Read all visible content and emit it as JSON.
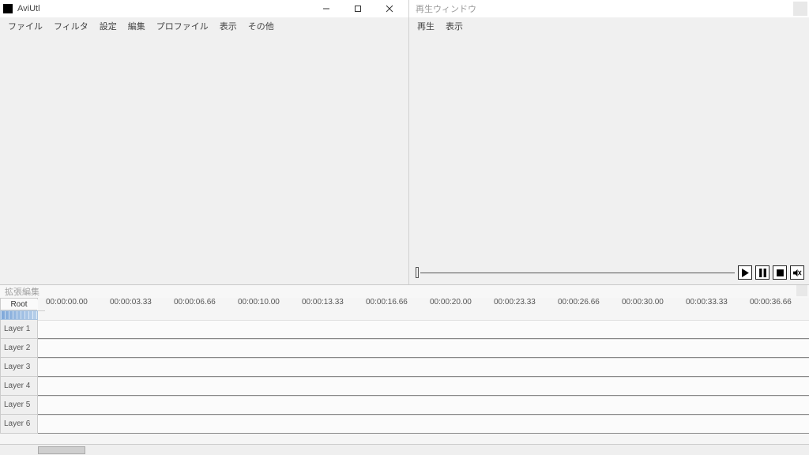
{
  "main_window": {
    "title": "AviUtl",
    "menu": [
      "ファイル",
      "フィルタ",
      "設定",
      "編集",
      "プロファイル",
      "表示",
      "その他"
    ]
  },
  "playback_window": {
    "title": "再生ウィンドウ",
    "menu": [
      "再生",
      "表示"
    ],
    "controls": {
      "play_icon": "play",
      "pause_icon": "pause",
      "stop_icon": "stop",
      "mute_icon": "mute"
    }
  },
  "timeline_window": {
    "title": "拡張編集",
    "root_label": "Root",
    "root_close": "×",
    "timecodes": [
      "00:00:00.00",
      "00:00:03.33",
      "00:00:06.66",
      "00:00:10.00",
      "00:00:13.33",
      "00:00:16.66",
      "00:00:20.00",
      "00:00:23.33",
      "00:00:26.66",
      "00:00:30.00",
      "00:00:33.33",
      "00:00:36.66"
    ],
    "major_tick_spacing_px": 81,
    "minor_ticks_per_major": 5,
    "layers": [
      "Layer 1",
      "Layer 2",
      "Layer 3",
      "Layer 4",
      "Layer 5",
      "Layer 6"
    ]
  }
}
